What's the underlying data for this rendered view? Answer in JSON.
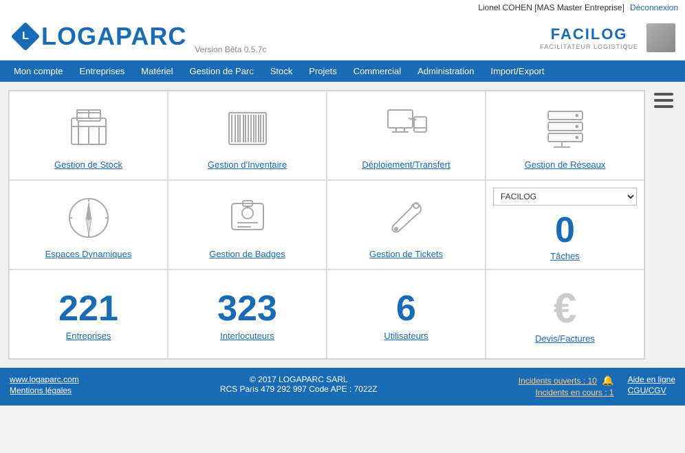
{
  "topbar": {
    "user": "Lionel COHEN [MAS Master Entreprise]",
    "logout_label": "Déconnexion"
  },
  "header": {
    "logo_text_left": "LOGA",
    "logo_text_right": "PARC",
    "version": "Version Bêta 0.5.7c",
    "facilog_brand": "FACILOG",
    "facilog_sub": "FACILITATEUR LOGISTIQUE"
  },
  "nav": {
    "items": [
      "Mon compte",
      "Entreprises",
      "Matériel",
      "Gestion de Parc",
      "Stock",
      "Projets",
      "Commercial",
      "Administration",
      "Import/Export"
    ]
  },
  "grid": {
    "cells": [
      {
        "id": "stock",
        "label": "Gestion de Stock",
        "type": "icon"
      },
      {
        "id": "inventaire",
        "label": "Gestion d'Inventaire",
        "type": "icon"
      },
      {
        "id": "deploiement",
        "label": "Déploiement/Transfert",
        "type": "icon"
      },
      {
        "id": "reseaux",
        "label": "Gestion de Réseaux",
        "type": "icon"
      },
      {
        "id": "espaces",
        "label": "Espaces Dynamiques",
        "type": "icon"
      },
      {
        "id": "badges",
        "label": "Gestion de Badges",
        "type": "icon"
      },
      {
        "id": "tickets",
        "label": "Gestion de Tickets",
        "type": "icon"
      },
      {
        "id": "taches",
        "label": "Tâches",
        "type": "tasks",
        "number": "0",
        "select_value": "FACILOG"
      },
      {
        "id": "entreprises",
        "label": "Entreprises",
        "type": "number",
        "number": "221"
      },
      {
        "id": "interlocuteurs",
        "label": "Interlocuteurs",
        "type": "number",
        "number": "323"
      },
      {
        "id": "utilisateurs",
        "label": "Utilisateurs",
        "type": "number",
        "number": "6"
      },
      {
        "id": "devis",
        "label": "Devis/Factures",
        "type": "euro"
      }
    ]
  },
  "footer": {
    "left_links": [
      "www.logaparc.com",
      "Mentions légales"
    ],
    "center_line1": "© 2017 LOGAPARC SARL",
    "center_line2": "RCS Paris 479 292 997  Code APE : 7022Z",
    "incidents_open": "Incidents ouverts : 10",
    "incidents_open_link": true,
    "incidents_ongoing": "Incidents en cours : 1",
    "incidents_ongoing_link": true,
    "aide_en_ligne": "Aide en ligne",
    "cgu": "CGU/CGV"
  }
}
